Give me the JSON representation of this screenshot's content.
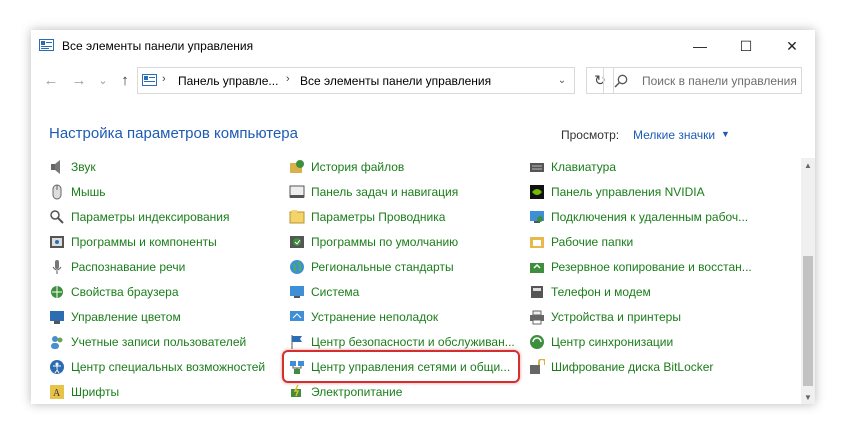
{
  "window": {
    "title": "Все элементы панели управления",
    "controls": {
      "minimize": "—",
      "maximize": "☐",
      "close": "✕"
    }
  },
  "nav": {
    "back": "←",
    "forward": "→",
    "dropdown": "⌄",
    "up": "↑",
    "breadcrumb": [
      "Панель управле...",
      "Все элементы панели управления"
    ],
    "refresh": "↻",
    "search_placeholder": "Поиск в панели управления"
  },
  "header": {
    "title": "Настройка параметров компьютера",
    "view_label": "Просмотр:",
    "view_value": "Мелкие значки"
  },
  "columns": [
    {
      "items": [
        {
          "label": "Звук",
          "icon": "speaker-icon"
        },
        {
          "label": "Мышь",
          "icon": "mouse-icon"
        },
        {
          "label": "Параметры индексирования",
          "icon": "indexing-icon"
        },
        {
          "label": "Программы и компоненты",
          "icon": "programs-icon"
        },
        {
          "label": "Распознавание речи",
          "icon": "microphone-icon"
        },
        {
          "label": "Свойства браузера",
          "icon": "browser-icon"
        },
        {
          "label": "Управление цветом",
          "icon": "color-management-icon"
        },
        {
          "label": "Учетные записи пользователей",
          "icon": "users-icon"
        },
        {
          "label": "Центр специальных возможностей",
          "icon": "accessibility-icon"
        },
        {
          "label": "Шрифты",
          "icon": "fonts-icon"
        }
      ]
    },
    {
      "items": [
        {
          "label": "История файлов",
          "icon": "file-history-icon"
        },
        {
          "label": "Панель задач и навигация",
          "icon": "taskbar-icon"
        },
        {
          "label": "Параметры Проводника",
          "icon": "explorer-options-icon"
        },
        {
          "label": "Программы по умолчанию",
          "icon": "default-programs-icon"
        },
        {
          "label": "Региональные стандарты",
          "icon": "globe-icon"
        },
        {
          "label": "Система",
          "icon": "system-icon"
        },
        {
          "label": "Устранение неполадок",
          "icon": "troubleshooting-icon"
        },
        {
          "label": "Центр безопасности и обслуживан...",
          "icon": "security-flag-icon"
        },
        {
          "label": "Центр управления сетями и общи...",
          "icon": "network-icon"
        },
        {
          "label": "Электропитание",
          "icon": "power-icon"
        }
      ]
    },
    {
      "items": [
        {
          "label": "Клавиатура",
          "icon": "keyboard-icon"
        },
        {
          "label": "Панель управления NVIDIA",
          "icon": "nvidia-icon"
        },
        {
          "label": "Подключения к удаленным рабоч...",
          "icon": "remote-desktop-icon"
        },
        {
          "label": "Рабочие папки",
          "icon": "work-folders-icon"
        },
        {
          "label": "Резервное копирование и восстан...",
          "icon": "backup-icon"
        },
        {
          "label": "Телефон и модем",
          "icon": "phone-icon"
        },
        {
          "label": "Устройства и принтеры",
          "icon": "printer-icon"
        },
        {
          "label": "Центр синхронизации",
          "icon": "sync-icon"
        },
        {
          "label": "Шифрование диска BitLocker",
          "icon": "bitlocker-icon"
        }
      ]
    }
  ],
  "colors": {
    "link": "#1a7d1a",
    "heading": "#1e5bb5",
    "highlight": "#d32f2f"
  }
}
